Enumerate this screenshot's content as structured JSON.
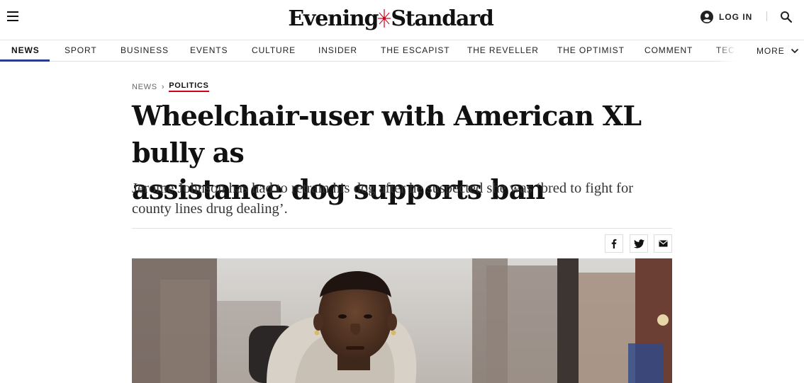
{
  "header": {
    "logo_left": "Evening",
    "logo_right": "Standard",
    "login_label": "LOG IN"
  },
  "nav": {
    "items": [
      {
        "label": "NEWS",
        "active": true
      },
      {
        "label": "SPORT"
      },
      {
        "label": "BUSINESS"
      },
      {
        "label": "EVENTS"
      },
      {
        "label": "CULTURE"
      },
      {
        "label": "INSIDER"
      },
      {
        "label": "THE ESCAPIST"
      },
      {
        "label": "THE REVELLER"
      },
      {
        "label": "THE OPTIMIST"
      },
      {
        "label": "COMMENT"
      },
      {
        "label": "TECH"
      }
    ],
    "more_label": "MORE"
  },
  "article": {
    "breadcrumb": {
      "section": "NEWS",
      "separator": "›",
      "subsection": "POLITICS"
    },
    "headline_line1": "Wheelchair-user with American XL bully as",
    "headline_line2": "assistance dog supports ban",
    "standfirst": "Jerome Johnson has had to retrain his dog after he suspected she was ‘bred to fight for county lines drug dealing’.",
    "share": {
      "facebook_icon": "facebook-icon",
      "twitter_icon": "twitter-icon",
      "email_icon": "email-icon"
    },
    "hero_image": "photo of man in wheelchair wearing a hoodie on a city street"
  },
  "colors": {
    "nav_active_underline": "#2a3b8f",
    "breadcrumb_accent": "#d0021b",
    "logo_star": "#d0021b"
  }
}
